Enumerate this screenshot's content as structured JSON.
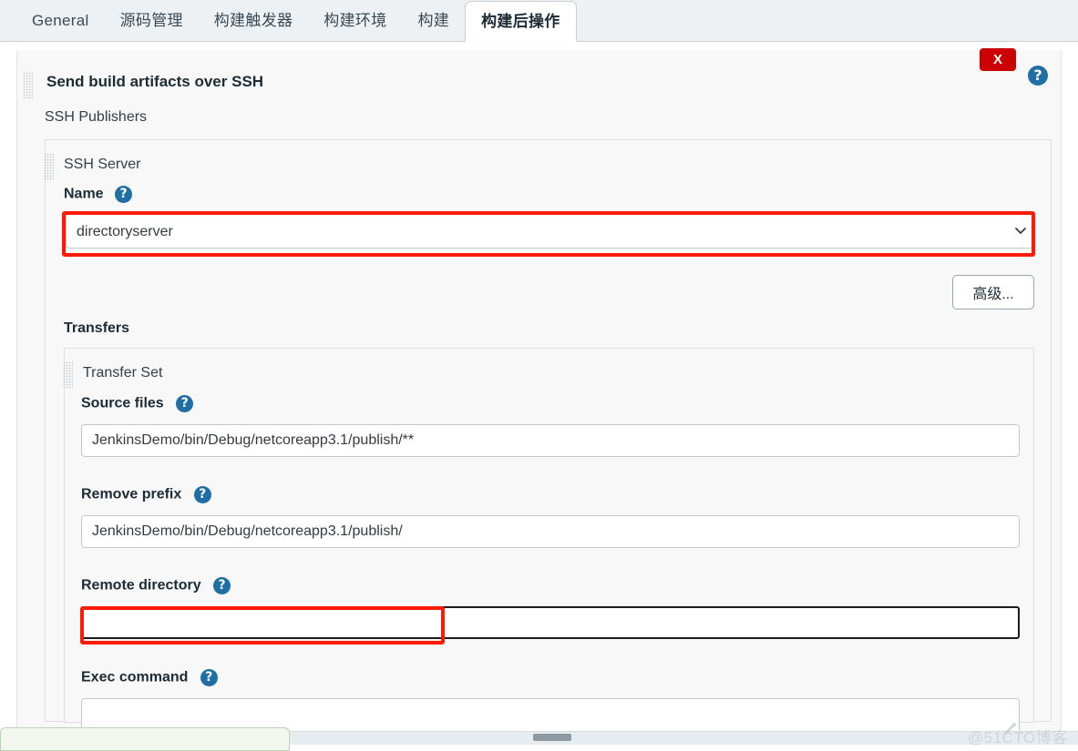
{
  "tabs": [
    {
      "label": "General",
      "active": false
    },
    {
      "label": "源码管理",
      "active": false
    },
    {
      "label": "构建触发器",
      "active": false
    },
    {
      "label": "构建环境",
      "active": false
    },
    {
      "label": "构建",
      "active": false
    },
    {
      "label": "构建后操作",
      "active": true
    }
  ],
  "header": {
    "title": "Send build artifacts over SSH",
    "close_label": "X",
    "help_glyph": "?"
  },
  "publishers": {
    "label": "SSH Publishers"
  },
  "ssh_server": {
    "label": "SSH Server",
    "name_label": "Name",
    "name_value": "directoryserver",
    "name_options": [
      "directoryserver"
    ],
    "chevron": "⌄",
    "advanced_button": "高级..."
  },
  "transfers": {
    "label": "Transfers",
    "transfer_set_label": "Transfer Set",
    "fields": [
      {
        "label": "Source files",
        "value": "JenkinsDemo/bin/Debug/netcoreapp3.1/publish/**",
        "placeholder": ""
      },
      {
        "label": "Remove prefix",
        "value": "JenkinsDemo/bin/Debug/netcoreapp3.1/publish/",
        "placeholder": ""
      },
      {
        "label": "Remote directory",
        "value": "",
        "placeholder": ""
      },
      {
        "label": "Exec command",
        "value": "",
        "placeholder": ""
      }
    ]
  },
  "watermark": {
    "text": "@51CTO博客"
  },
  "colors": {
    "annotation_red": "#ff1a00",
    "close_red": "#cc0000",
    "help_blue": "#1f6fa5",
    "tabbar_bg": "#eef1f4",
    "panel_bg": "#f8f8f8"
  }
}
